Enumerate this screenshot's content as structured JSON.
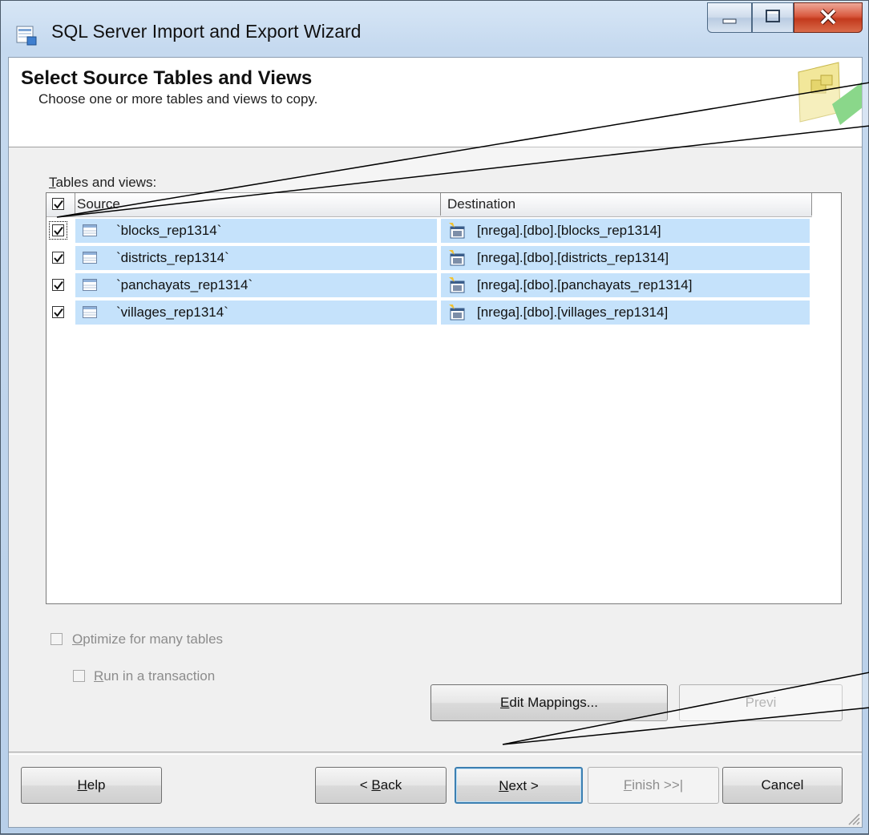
{
  "window": {
    "title": "SQL Server Import and Export Wizard",
    "controls": {
      "minimize": "minimize",
      "maximize": "maximize",
      "close": "close"
    }
  },
  "header": {
    "title": "Select Source Tables and Views",
    "subtitle": "Choose one or more tables and views to copy."
  },
  "tables_label": {
    "mnemonic": "T",
    "rest": "ables and views:"
  },
  "grid": {
    "columns": {
      "source": "Source",
      "destination": "Destination"
    },
    "header_checked": true,
    "rows": [
      {
        "checked": true,
        "source": "`blocks_rep1314`",
        "destination": "[nrega].[dbo].[blocks_rep1314]"
      },
      {
        "checked": true,
        "source": "`districts_rep1314`",
        "destination": "[nrega].[dbo].[districts_rep1314]"
      },
      {
        "checked": true,
        "source": "`panchayats_rep1314`",
        "destination": "[nrega].[dbo].[panchayats_rep1314]"
      },
      {
        "checked": true,
        "source": "`villages_rep1314`",
        "destination": "[nrega].[dbo].[villages_rep1314]"
      }
    ]
  },
  "options": {
    "optimize": {
      "mnemonic": "O",
      "rest": "ptimize for many tables",
      "checked": false
    },
    "transaction": {
      "mnemonic": "R",
      "rest": "un in a transaction",
      "checked": false
    }
  },
  "buttons": {
    "edit_mappings": {
      "mnemonic": "E",
      "rest": "dit Mappings..."
    },
    "preview": "Previ",
    "help": {
      "mnemonic": "H",
      "rest": "elp"
    },
    "back": {
      "pre": "< ",
      "mnemonic": "B",
      "rest": "ack"
    },
    "next": {
      "mnemonic": "N",
      "rest": "ext >"
    },
    "finish": {
      "mnemonic": "F",
      "rest": "inish >>|"
    },
    "cancel": "Cancel"
  },
  "colors": {
    "row_highlight": "#c5e2fb",
    "default_button_border": "#3c7fb1"
  }
}
